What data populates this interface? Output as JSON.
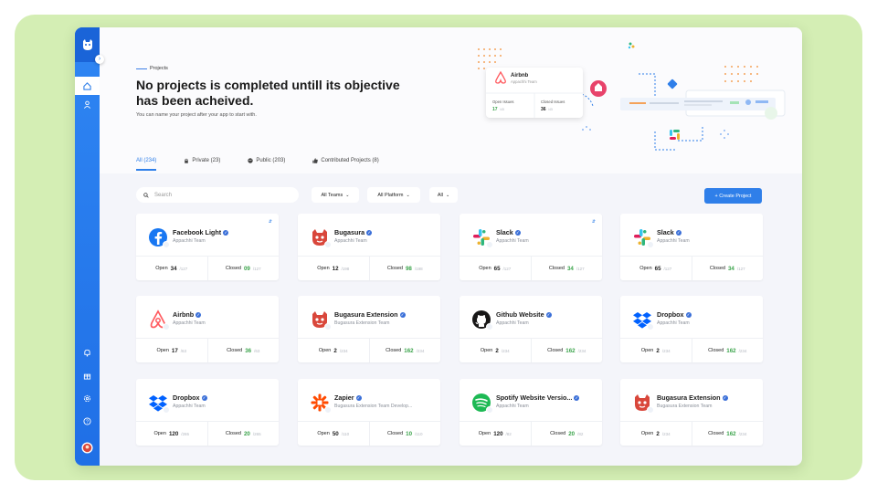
{
  "sidebar": {
    "icons": [
      "tiger-logo-icon",
      "home-icon",
      "user-icon",
      "bell-icon",
      "gift-icon",
      "settings-icon",
      "help-icon",
      "avatar"
    ]
  },
  "hero": {
    "eyebrow": "Projects",
    "title": "No projects is completed untill its objective has been acheived.",
    "subtitle": "You can name your project after your app to start with."
  },
  "illustration": {
    "name": "Airbnb",
    "team": "Appachhi Team",
    "open_label": "Open Issues",
    "open_value": "17",
    "open_total": "/45",
    "closed_label": "Closed Issues",
    "closed_value": "36",
    "closed_total": "/45"
  },
  "tabs": [
    {
      "label": "All (234)",
      "icon": "",
      "active": true
    },
    {
      "label": "Private (23)",
      "icon": "lock-icon",
      "active": false
    },
    {
      "label": "Public (203)",
      "icon": "globe-icon",
      "active": false
    },
    {
      "label": "Contributed Projects (8)",
      "icon": "thumbs-up-icon",
      "active": false
    }
  ],
  "toolbar": {
    "search_placeholder": "Search",
    "teams_filter": "All Teams",
    "platform_filter": "All Platform",
    "all_filter": "All",
    "create_label": "+ Create Project"
  },
  "stat_labels": {
    "open": "Open",
    "closed": "Closed"
  },
  "projects": [
    {
      "name": "Facebook Light",
      "team": "Appachhi Team",
      "logo": "facebook",
      "open": "34",
      "open_total": "/127",
      "closed": "09",
      "closed_total": "/127",
      "pinned": true
    },
    {
      "name": "Bugasura",
      "team": "Appachhi Team",
      "logo": "bugasura",
      "open": "12",
      "open_total": "/198",
      "closed": "98",
      "closed_total": "/198",
      "pinned": false
    },
    {
      "name": "Slack",
      "team": "Appachhi Team",
      "logo": "slack",
      "open": "65",
      "open_total": "/127",
      "closed": "34",
      "closed_total": "/127",
      "pinned": true
    },
    {
      "name": "Slack",
      "team": "Appachhi Team",
      "logo": "slack",
      "open": "65",
      "open_total": "/127",
      "closed": "34",
      "closed_total": "/127",
      "pinned": false
    },
    {
      "name": "Airbnb",
      "team": "Appachhi Team",
      "logo": "airbnb",
      "open": "17",
      "open_total": "/63",
      "closed": "36",
      "closed_total": "/63",
      "pinned": false
    },
    {
      "name": "Bugasura Extension",
      "team": "Bugasura Extension Team",
      "logo": "bugasura",
      "open": "2",
      "open_total": "/234",
      "closed": "162",
      "closed_total": "/234",
      "pinned": false
    },
    {
      "name": "Github Website",
      "team": "Appachhi Team",
      "logo": "github",
      "open": "2",
      "open_total": "/234",
      "closed": "162",
      "closed_total": "/234",
      "pinned": false
    },
    {
      "name": "Dropbox",
      "team": "Appachhi Team",
      "logo": "dropbox",
      "open": "2",
      "open_total": "/234",
      "closed": "162",
      "closed_total": "/234",
      "pinned": false
    },
    {
      "name": "Dropbox",
      "team": "Appachhi Team",
      "logo": "dropbox",
      "open": "120",
      "open_total": "/265",
      "closed": "20",
      "closed_total": "/265",
      "pinned": false
    },
    {
      "name": "Zapier",
      "team": "Bugasura Extension Team Develop...",
      "logo": "zapier",
      "open": "50",
      "open_total": "/110",
      "closed": "10",
      "closed_total": "/110",
      "pinned": false
    },
    {
      "name": "Spotify Website Versio...",
      "team": "Appachhi Team",
      "logo": "spotify",
      "open": "120",
      "open_total": "/82",
      "closed": "20",
      "closed_total": "/82",
      "pinned": false
    },
    {
      "name": "Bugasura Extension",
      "team": "Bugasura Extension Team",
      "logo": "bugasura",
      "open": "2",
      "open_total": "/234",
      "closed": "162",
      "closed_total": "/234",
      "pinned": false
    }
  ]
}
